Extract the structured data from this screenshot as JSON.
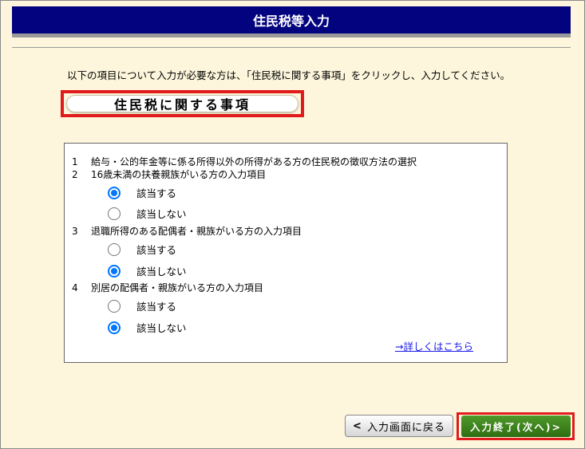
{
  "header": {
    "title": "住民税等入力"
  },
  "instruction": "以下の項目について入力が必要な方は、「住民税に関する事項」をクリックし、入力してください。",
  "section_button": "住民税に関する事項",
  "items": [
    {
      "num": "1",
      "text": "給与・公的年金等に係る所得以外の所得がある方の住民税の徴収方法の選択"
    },
    {
      "num": "2",
      "text": "16歳未満の扶養親族がいる方の入力項目",
      "options": [
        "該当する",
        "該当しない"
      ],
      "selected": "該当する"
    },
    {
      "num": "3",
      "text": "退職所得のある配偶者・親族がいる方の入力項目",
      "options": [
        "該当する",
        "該当しない"
      ],
      "selected": "該当しない"
    },
    {
      "num": "4",
      "text": "別居の配偶者・親族がいる方の入力項目",
      "options": [
        "該当する",
        "該当しない"
      ],
      "selected": "該当しない"
    }
  ],
  "detail_link": "→詳しくはこちら",
  "footer": {
    "back_chevron": "<",
    "back_label": "入力画面に戻る",
    "next_label": "入力終了(次へ)>"
  },
  "colors": {
    "title_bar": "#030380",
    "highlight": "#e11b1b",
    "next_button": "#3a7d18",
    "radio_selected": "#0075ff"
  }
}
